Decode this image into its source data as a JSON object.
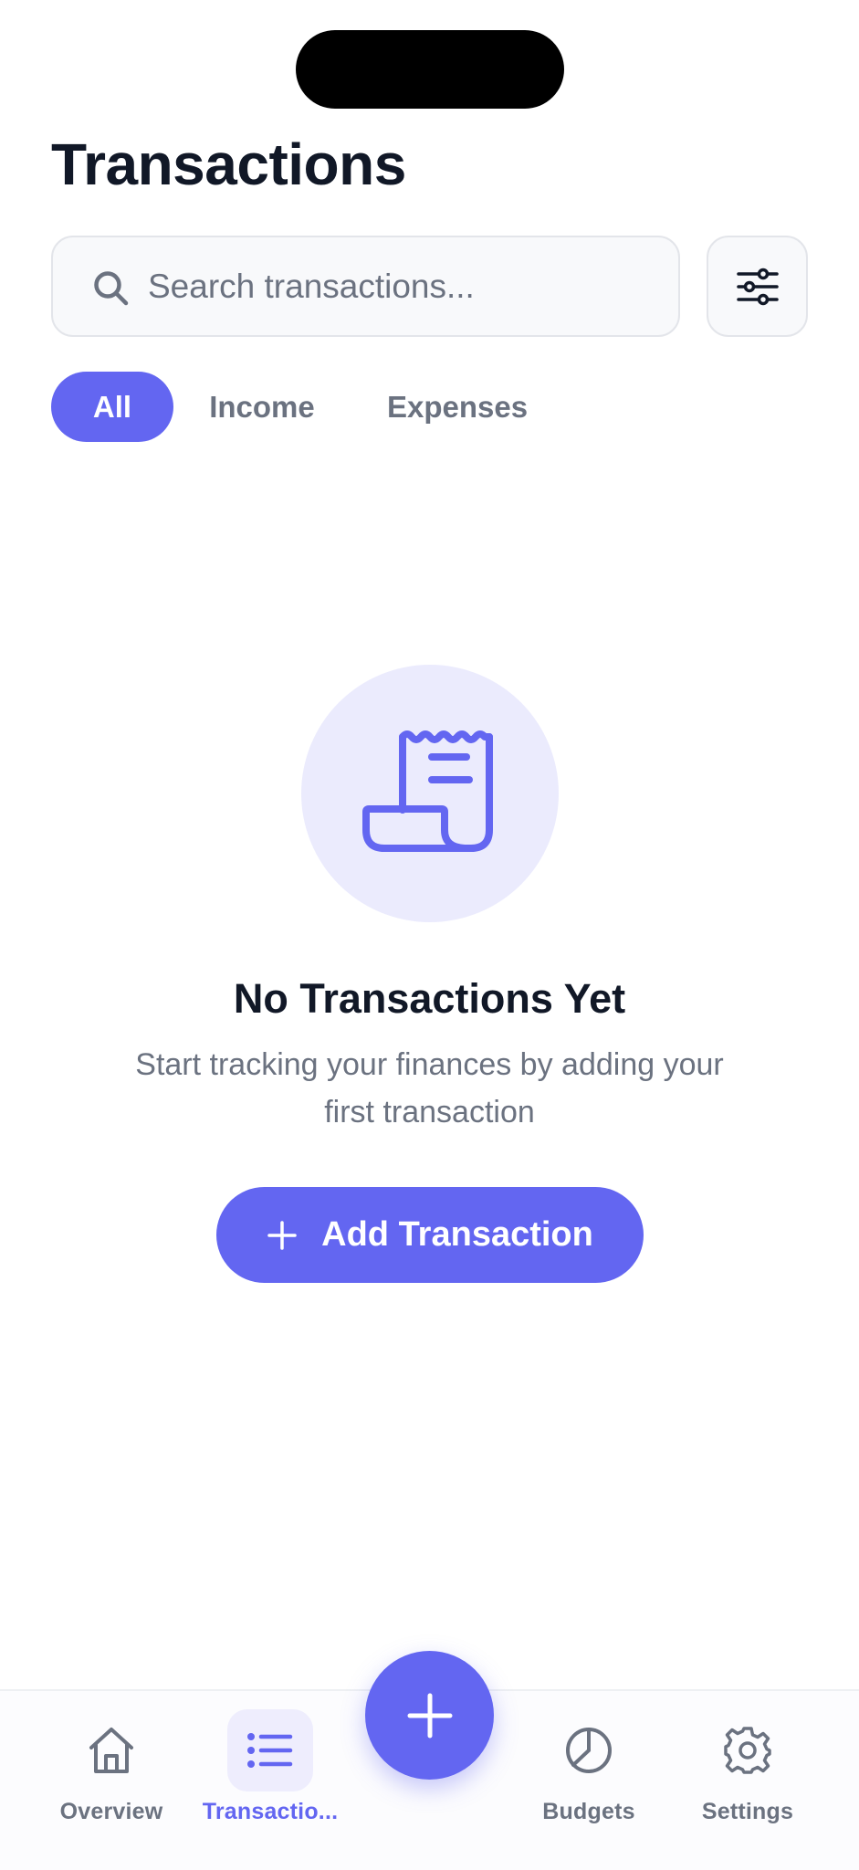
{
  "header": {
    "title": "Transactions"
  },
  "search": {
    "placeholder": "Search transactions..."
  },
  "filters": [
    {
      "label": "All",
      "active": true
    },
    {
      "label": "Income",
      "active": false
    },
    {
      "label": "Expenses",
      "active": false
    }
  ],
  "empty_state": {
    "icon": "receipt-icon",
    "title": "No Transactions Yet",
    "description": "Start tracking your finances by adding your first transaction",
    "button_label": "Add Transaction"
  },
  "tabbar": {
    "items": [
      {
        "label": "Overview",
        "icon": "home-icon",
        "active": false
      },
      {
        "label": "Transactio...",
        "icon": "list-icon",
        "active": true
      },
      {
        "label": "Budgets",
        "icon": "pie-chart-icon",
        "active": false
      },
      {
        "label": "Settings",
        "icon": "gear-icon",
        "active": false
      }
    ],
    "fab_icon": "plus-icon"
  },
  "colors": {
    "accent": "#6366f1",
    "accent_light": "#ebebfd",
    "text_primary": "#111827",
    "text_secondary": "#6b7280"
  }
}
